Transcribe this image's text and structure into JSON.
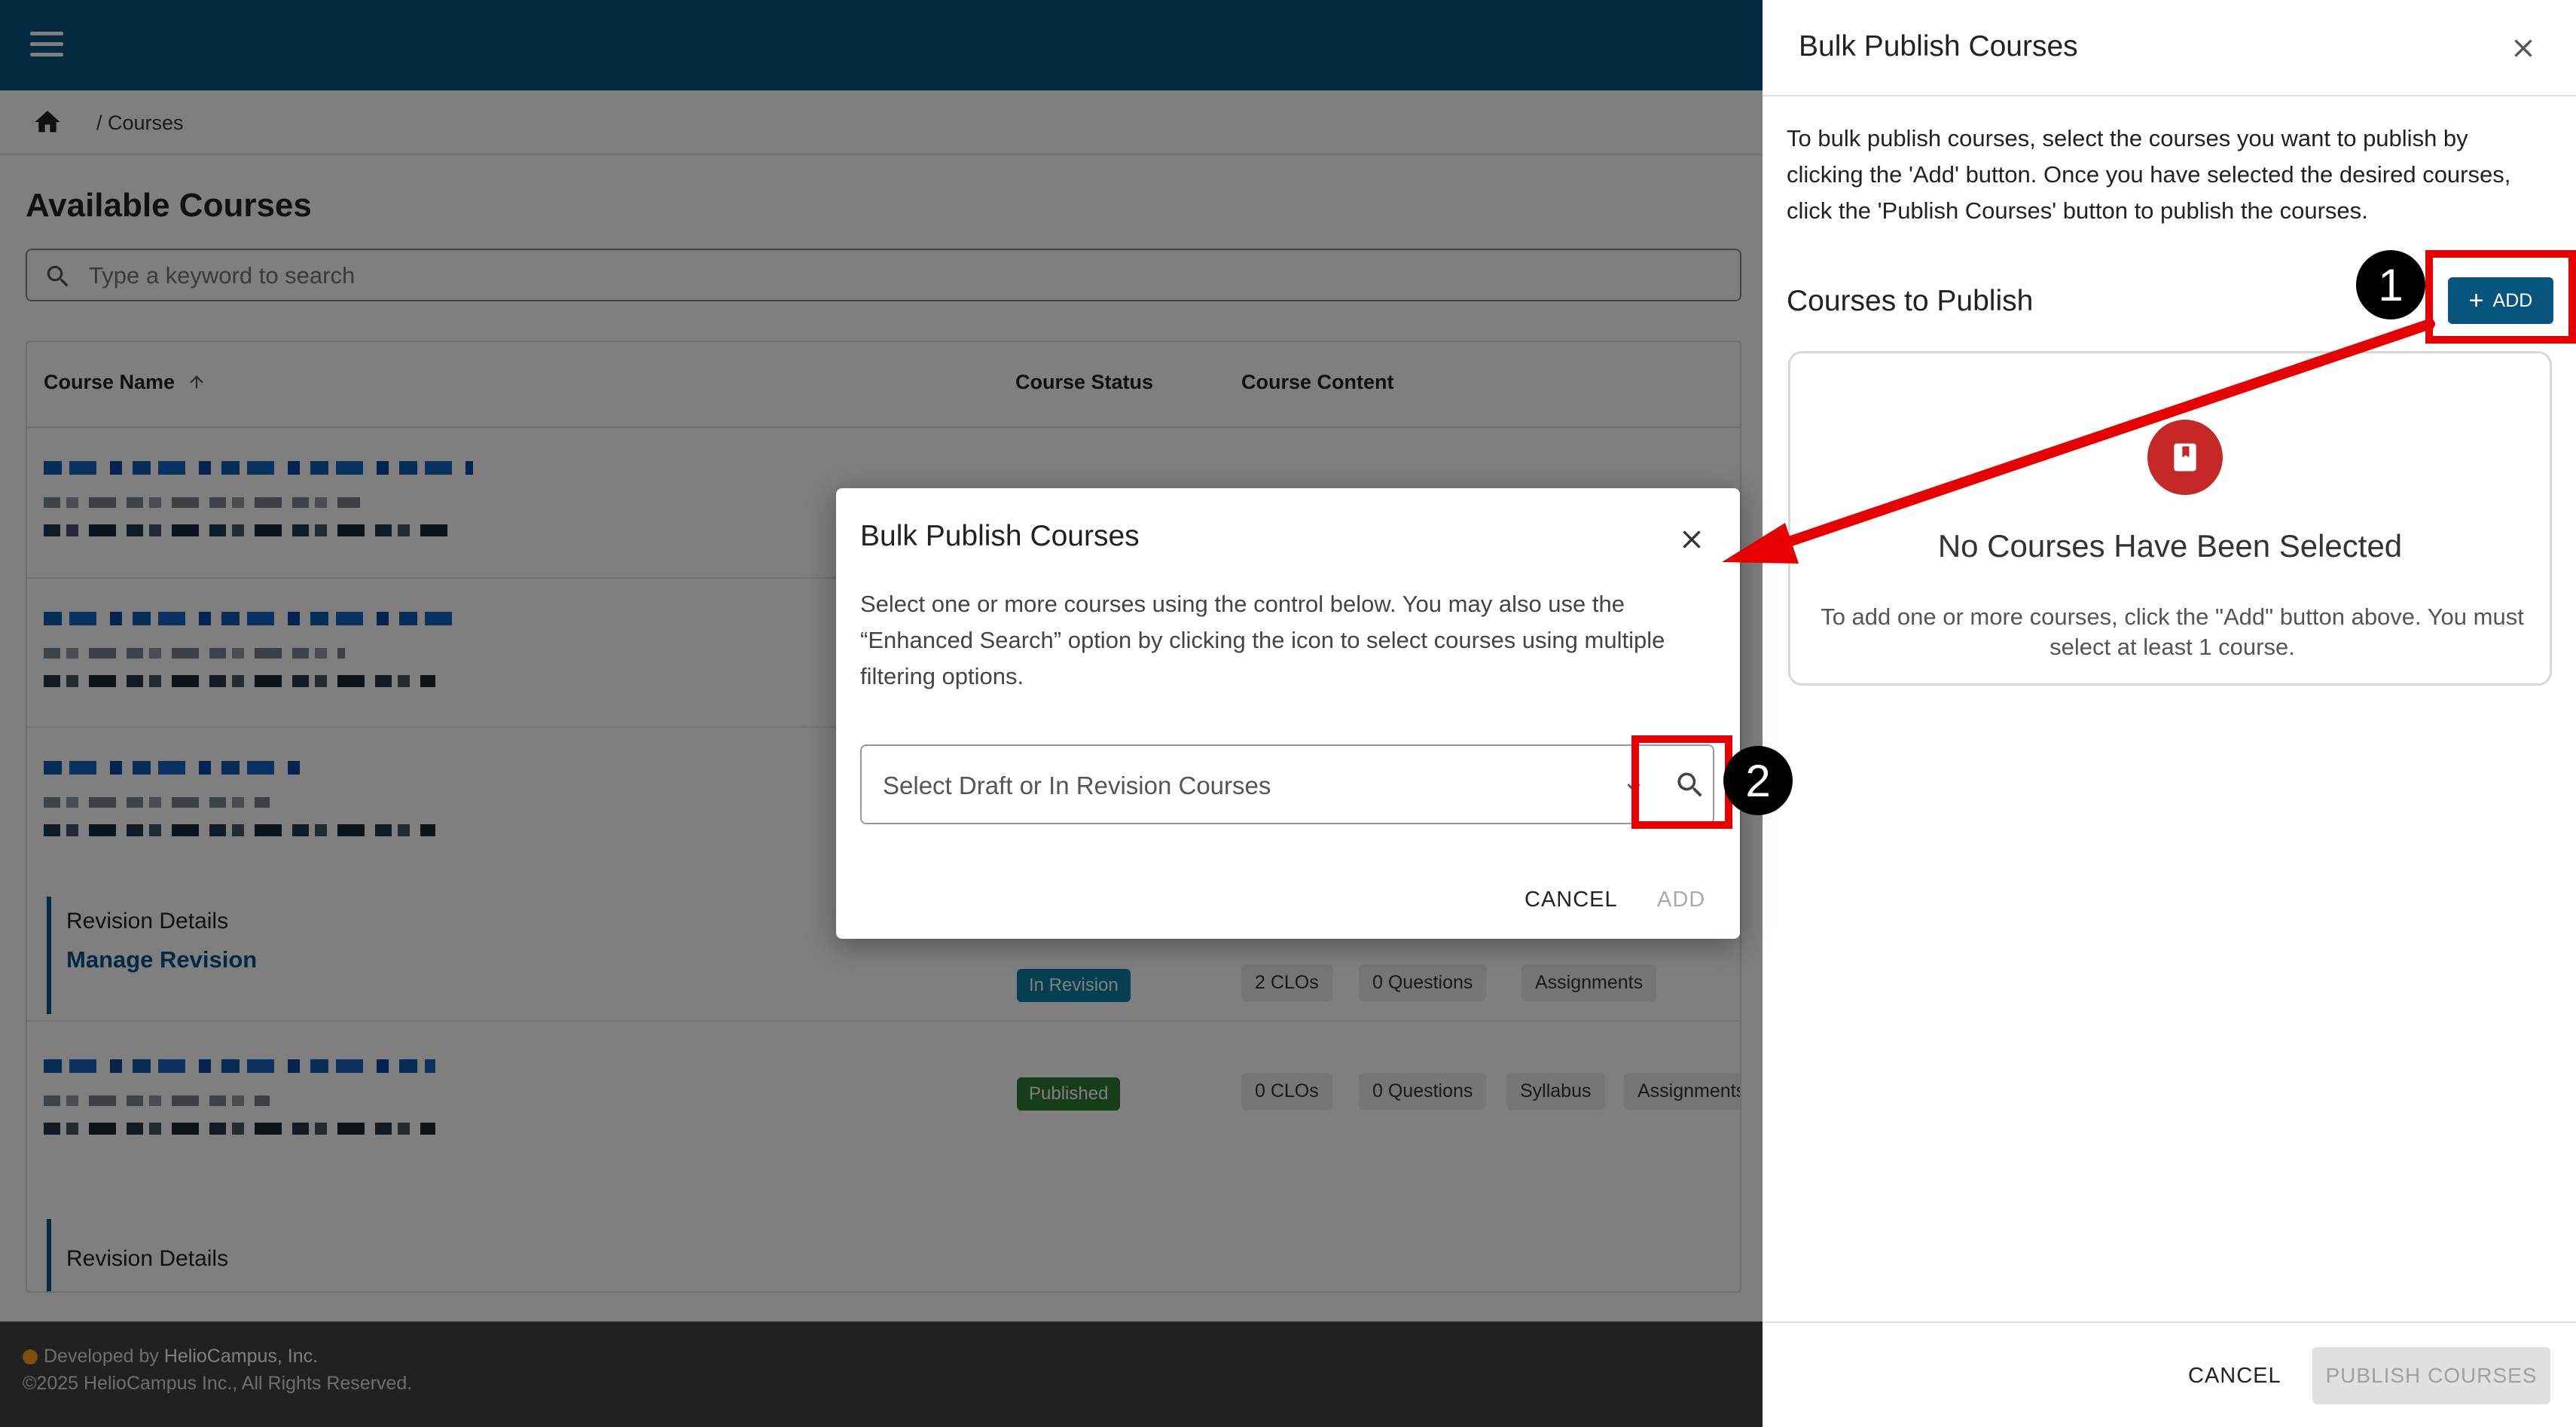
{
  "breadcrumb": {
    "current": "Courses"
  },
  "page": {
    "title": "Available Courses",
    "search_placeholder": "Type a keyword to search"
  },
  "table": {
    "headers": {
      "name": "Course Name",
      "status": "Course Status",
      "content": "Course Content"
    },
    "rows": [
      {
        "status": "In Revision",
        "revision_title": "Revision Details",
        "revision_link": "Manage Revision",
        "chips": [
          "2 CLOs",
          "0 Questions",
          "Assignments"
        ]
      },
      {
        "status": "Published",
        "chips": [
          "0 CLOs",
          "0 Questions",
          "Syllabus",
          "Assignments"
        ]
      }
    ],
    "partial_revision_title": "Revision Details"
  },
  "footer": {
    "developed_prefix": "Developed by ",
    "developer": "HelioCampus, Inc.",
    "copyright": "©2025 HelioCampus Inc., All Rights Reserved."
  },
  "drawer": {
    "title": "Bulk Publish Courses",
    "description": "To bulk publish courses, select the courses you want to publish by clicking the 'Add' button. Once you have selected the desired courses, click the 'Publish Courses' button to publish the courses.",
    "section_title": "Courses to Publish",
    "add_label": "ADD",
    "empty_title": "No Courses Have Been Selected",
    "empty_subtitle": "To add one or more courses, click the \"Add\" button above. You must select at least 1 course.",
    "cancel_label": "CANCEL",
    "publish_label": "PUBLISH COURSES"
  },
  "dialog": {
    "title": "Bulk Publish Courses",
    "description": "Select one or more courses using the control below. You may also use the “Enhanced Search” option by clicking the icon to select courses using multiple filtering options.",
    "select_placeholder": "Select Draft or In Revision Courses",
    "cancel_label": "CANCEL",
    "add_label": "ADD"
  },
  "annotations": {
    "step1": "1",
    "step2": "2"
  },
  "colors": {
    "appbar": "#07547c",
    "accent": "#07547c",
    "highlight": "#e60000",
    "published": "#2e7d32",
    "empty_icon": "#c62828"
  }
}
